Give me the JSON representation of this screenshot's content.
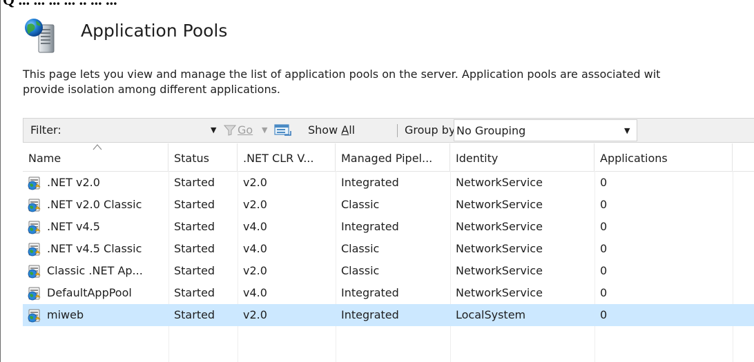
{
  "top_fragment": "Q ... ... ... ... .. ... ...",
  "header": {
    "title": "Application Pools",
    "icon": "server-globe-icon"
  },
  "description": {
    "line1": "This page lets you view and manage the list of application pools on the server. Application pools are associated wit",
    "line2": "provide isolation among different applications."
  },
  "toolbar": {
    "filter_label": "Filter:",
    "filter_value": "",
    "go_label": "Go",
    "show_all_label": "Show All",
    "group_by_label": "Group by:",
    "grouping_value": "No Grouping"
  },
  "table": {
    "columns": [
      ".NET CLR V...",
      "Managed Pipel...",
      "Identity",
      "Applications"
    ],
    "name_header": "Name",
    "status_header": "Status",
    "sorted_column": "Name",
    "rows": [
      {
        "name": ".NET v2.0",
        "status": "Started",
        "clr": "v2.0",
        "pipeline": "Integrated",
        "identity": "NetworkService",
        "applications": "0"
      },
      {
        "name": ".NET v2.0 Classic",
        "status": "Started",
        "clr": "v2.0",
        "pipeline": "Classic",
        "identity": "NetworkService",
        "applications": "0"
      },
      {
        "name": ".NET v4.5",
        "status": "Started",
        "clr": "v4.0",
        "pipeline": "Integrated",
        "identity": "NetworkService",
        "applications": "0"
      },
      {
        "name": ".NET v4.5 Classic",
        "status": "Started",
        "clr": "v4.0",
        "pipeline": "Classic",
        "identity": "NetworkService",
        "applications": "0"
      },
      {
        "name": "Classic .NET Ap...",
        "status": "Started",
        "clr": "v2.0",
        "pipeline": "Classic",
        "identity": "NetworkService",
        "applications": "0"
      },
      {
        "name": "DefaultAppPool",
        "status": "Started",
        "clr": "v4.0",
        "pipeline": "Integrated",
        "identity": "NetworkService",
        "applications": "0"
      },
      {
        "name": "miweb",
        "status": "Started",
        "clr": "v2.0",
        "pipeline": "Integrated",
        "identity": "LocalSystem",
        "applications": "0",
        "selected": true
      }
    ]
  },
  "colors": {
    "selection": "#cce8ff",
    "toolbar_bg": "#f0f0f0",
    "disabled_text": "#a0a0a0"
  }
}
